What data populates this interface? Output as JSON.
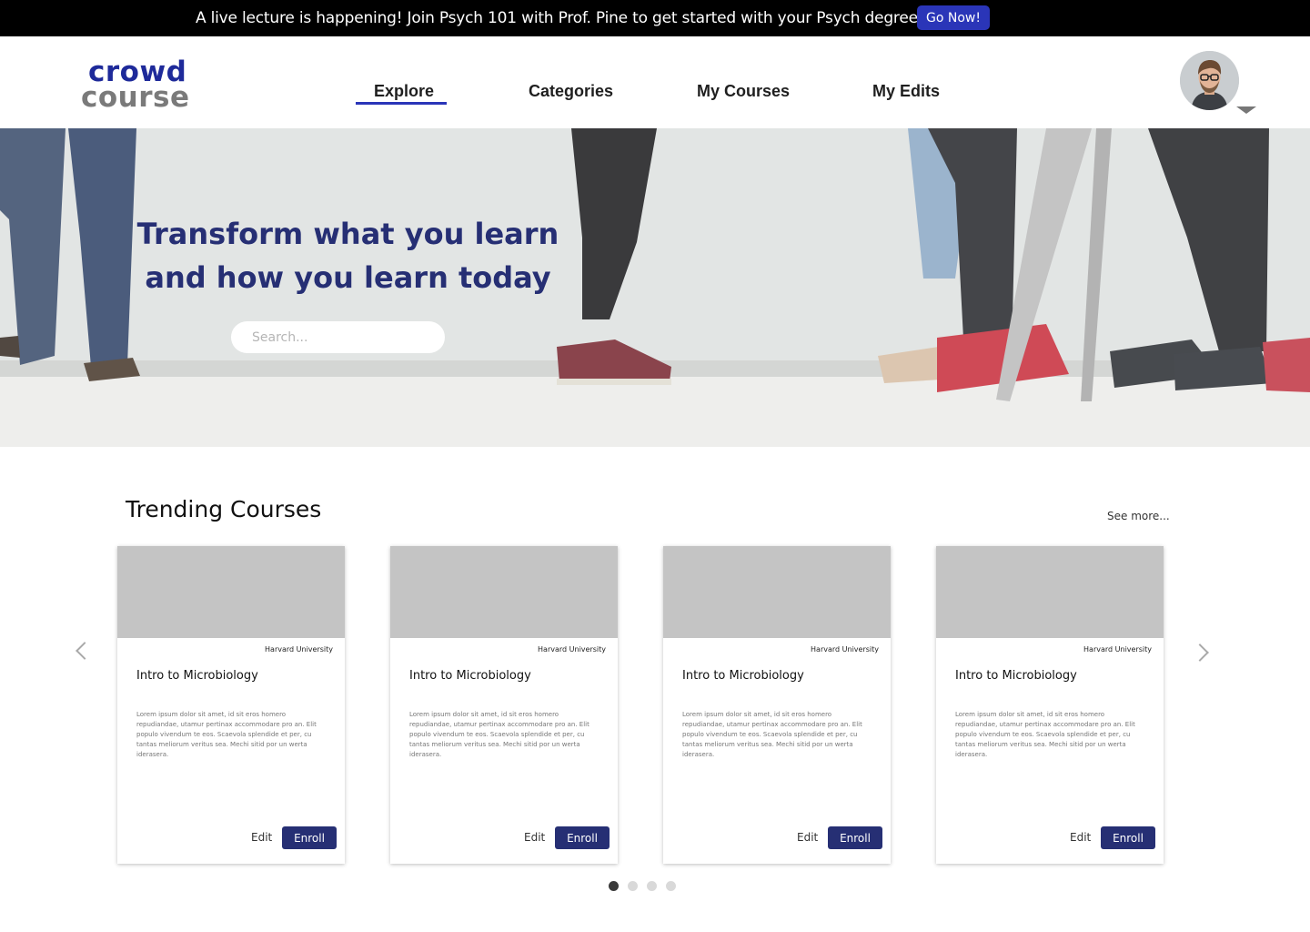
{
  "announcement": {
    "text": "A live lecture is happening! Join Psych 101 with Prof. Pine to get started with your Psych degree!",
    "button_label": "Go Now!"
  },
  "header": {
    "logo_top": "crowd",
    "logo_bottom": "course",
    "nav": [
      {
        "label": "Explore",
        "active": true
      },
      {
        "label": "Categories",
        "active": false
      },
      {
        "label": "My Courses",
        "active": false
      },
      {
        "label": "My Edits",
        "active": false
      }
    ],
    "avatar_icon": "user-avatar",
    "caret_icon": "caret-down-icon"
  },
  "hero": {
    "title": "Transform what you learn and how you learn today",
    "search_placeholder": "Search..."
  },
  "trending": {
    "title": "Trending Courses",
    "see_more": "See more...",
    "cards": [
      {
        "university": "Harvard University",
        "title": "Intro to Microbiology",
        "description": "Lorem ipsum dolor sit amet, id sit eros homero repudiandae, utamur pertinax accommodare pro an. Elit populo vivendum te eos. Scaevola splendide et per, cu tantas meliorum veritus sea. Mechi sitid por un werta iderasera.",
        "edit_label": "Edit",
        "enroll_label": "Enroll"
      },
      {
        "university": "Harvard University",
        "title": "Intro to Microbiology",
        "description": "Lorem ipsum dolor sit amet, id sit eros homero repudiandae, utamur pertinax accommodare pro an. Elit populo vivendum te eos. Scaevola splendide et per, cu tantas meliorum veritus sea. Mechi sitid por un werta iderasera.",
        "edit_label": "Edit",
        "enroll_label": "Enroll"
      },
      {
        "university": "Harvard University",
        "title": "Intro to Microbiology",
        "description": "Lorem ipsum dolor sit amet, id sit eros homero repudiandae, utamur pertinax accommodare pro an. Elit populo vivendum te eos. Scaevola splendide et per, cu tantas meliorum veritus sea. Mechi sitid por un werta iderasera.",
        "edit_label": "Edit",
        "enroll_label": "Enroll"
      },
      {
        "university": "Harvard University",
        "title": "Intro to Microbiology",
        "description": "Lorem ipsum dolor sit amet, id sit eros homero repudiandae, utamur pertinax accommodare pro an. Elit populo vivendum te eos. Scaevola splendide et per, cu tantas meliorum veritus sea. Mechi sitid por un werta iderasera.",
        "edit_label": "Edit",
        "enroll_label": "Enroll"
      }
    ],
    "carousel": {
      "page_count": 4,
      "active_page": 1
    },
    "prev_icon": "chevron-left-icon",
    "next_icon": "chevron-right-icon"
  },
  "colors": {
    "accent": "#2a35b8",
    "brand_dark": "#262f74",
    "announcement_bg": "#000000",
    "card_image_placeholder": "#c4c4c4"
  }
}
